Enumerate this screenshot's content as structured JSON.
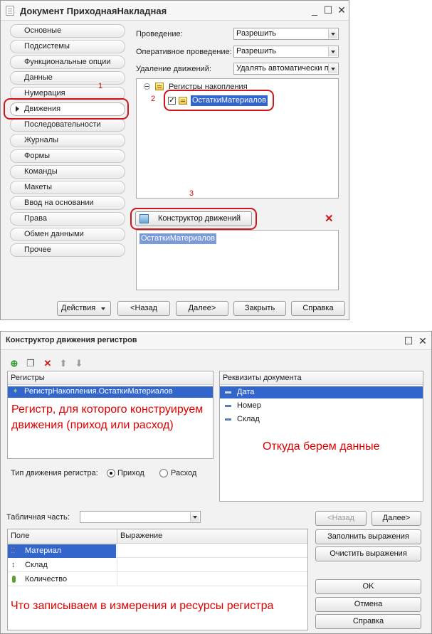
{
  "window1": {
    "title": "Документ ПриходнаяНакладная",
    "controls": {
      "minimize": "_",
      "maximize": "☐",
      "close": "✕"
    },
    "sidebar": [
      {
        "label": "Основные"
      },
      {
        "label": "Подсистемы"
      },
      {
        "label": "Функциональные опции"
      },
      {
        "label": "Данные"
      },
      {
        "label": "Нумерация"
      },
      {
        "label": "Движения",
        "active": true
      },
      {
        "label": "Последовательности"
      },
      {
        "label": "Журналы"
      },
      {
        "label": "Формы"
      },
      {
        "label": "Команды"
      },
      {
        "label": "Макеты"
      },
      {
        "label": "Ввод на основании"
      },
      {
        "label": "Права"
      },
      {
        "label": "Обмен данными"
      },
      {
        "label": "Прочее"
      }
    ],
    "fields": {
      "posting_label": "Проведение:",
      "posting_value": "Разрешить",
      "realtime_label": "Оперативное проведение:",
      "realtime_value": "Разрешить",
      "delete_label": "Удаление движений:",
      "delete_value": "Удалять автоматически п"
    },
    "tree": {
      "root": "Регистры накопления",
      "item": "ОстаткиМатериалов",
      "item_checked": true
    },
    "constructor_button": "Конструктор движений",
    "selected_list": [
      "ОстаткиМатериалов"
    ],
    "annotations": {
      "n1": "1",
      "n2": "2",
      "n3": "3"
    },
    "footer": {
      "actions": "Действия",
      "back": "<Назад",
      "next": "Далее>",
      "close": "Закрыть",
      "help": "Справка"
    }
  },
  "window2": {
    "title": "Конструктор движения регистров",
    "controls": {
      "maximize": "☐",
      "close": "✕"
    },
    "registers": {
      "header": "Регистры",
      "item": "РегистрНакопления.ОстаткиМатериалов",
      "note": "Регистр, для которого конструируем движения (приход или расход)"
    },
    "movement_type": {
      "label": "Тип движения регистра:",
      "options": [
        "Приход",
        "Расход"
      ],
      "selected": "Приход"
    },
    "requisites": {
      "header": "Реквизиты документа",
      "items": [
        "Дата",
        "Номер",
        "Склад"
      ],
      "note": "Откуда берем данные"
    },
    "tabular": {
      "label": "Табличная часть:",
      "value": ""
    },
    "nav": {
      "back": "<Назад",
      "next": "Далее>"
    },
    "grid": {
      "col_field": "Поле",
      "col_expression": "Выражение",
      "rows": [
        {
          "field": "Материал",
          "expression": ""
        },
        {
          "field": "Склад",
          "expression": ""
        },
        {
          "field": "Количество",
          "expression": ""
        }
      ],
      "note": "Что записываем в измерения и ресурсы регистра"
    },
    "buttons": {
      "fill": "Заполнить выражения",
      "clear": "Очистить выражения",
      "ok": "OK",
      "cancel": "Отмена",
      "help": "Справка"
    },
    "colors": {
      "selection": "#3366cc",
      "annotation_red": "#e00000"
    }
  }
}
